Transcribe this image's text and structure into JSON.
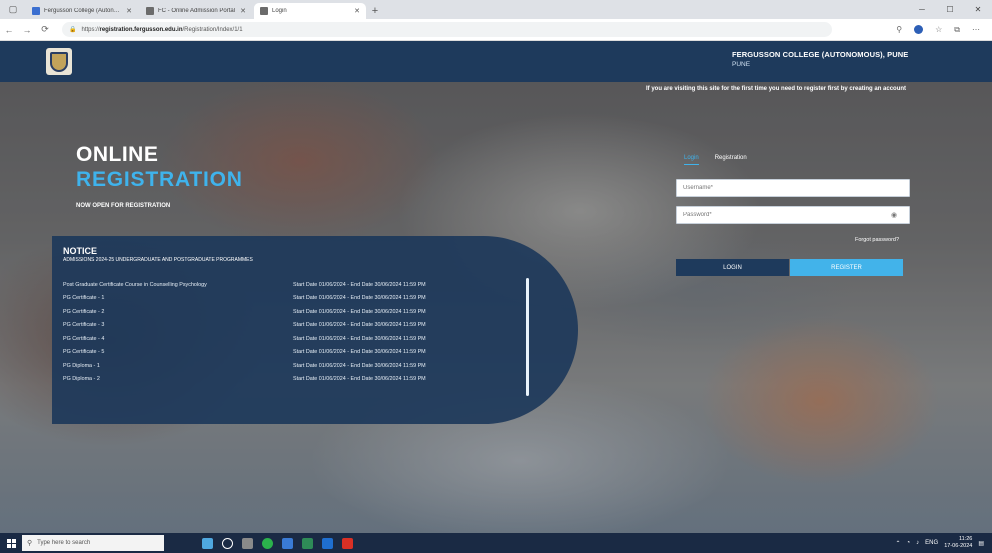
{
  "browser": {
    "tabs": [
      {
        "title": "Fergusson College (Autonomous)",
        "active": false
      },
      {
        "title": "FC - Online Admission Portal",
        "active": false
      },
      {
        "title": "Login",
        "active": true
      }
    ],
    "new_tab": "+",
    "url_prefix": "https://",
    "url_host": "registration.fergusson.edu.in",
    "url_path": "/Registration/Index/1/1"
  },
  "header": {
    "college_name": "FERGUSSON COLLEGE (AUTONOMOUS), PUNE",
    "college_city": "PUNE"
  },
  "first_time_note": "If you are visiting this site for the first time you need to register first by creating an account",
  "hero": {
    "line1": "ONLINE",
    "line2": "REGISTRATION",
    "line3": "NOW OPEN FOR REGISTRATION"
  },
  "notice": {
    "title": "NOTICE",
    "subtitle": "ADMISSIONS 2024-25 UNDERGRADUATE AND POSTGRADUATE PROGRAMMES",
    "rows": [
      {
        "name": "Post Graduate Certificate Course in Counselling Psychology",
        "date": "Start Date 01/06/2024 - End Date 30/06/2024 11:59 PM"
      },
      {
        "name": "PG Certificate - 1",
        "date": "Start Date 01/06/2024 - End Date 30/06/2024 11:59 PM"
      },
      {
        "name": "PG Certificate - 2",
        "date": "Start Date 01/06/2024 - End Date 30/06/2024 11:59 PM"
      },
      {
        "name": "PG Certificate - 3",
        "date": "Start Date 01/06/2024 - End Date 30/06/2024 11:59 PM"
      },
      {
        "name": "PG Certificate - 4",
        "date": "Start Date 01/06/2024 - End Date 30/06/2024 11:59 PM"
      },
      {
        "name": "PG Certificate - 5",
        "date": "Start Date 01/06/2024 - End Date 30/06/2024 11:59 PM"
      },
      {
        "name": "PG Diploma - 1",
        "date": "Start Date 01/06/2024 - End Date 30/06/2024 11:59 PM"
      },
      {
        "name": "PG Diploma - 2",
        "date": "Start Date 01/06/2024 - End Date 30/06/2024 11:59 PM"
      }
    ]
  },
  "login": {
    "tab_login": "Login",
    "tab_register": "Registration",
    "username_placeholder": "Username*",
    "password_placeholder": "Password*",
    "forgot": "Forgot password?",
    "login_button": "LOGIN",
    "register_button": "REGISTER"
  },
  "taskbar": {
    "search_placeholder": "Type here to search",
    "tray_text": "ENG",
    "time": "11:26",
    "date": "17-06-2024"
  },
  "colors": {
    "header": "#1e3a5c",
    "accent": "#3fb3ec",
    "register_button": "#42b3ea"
  }
}
